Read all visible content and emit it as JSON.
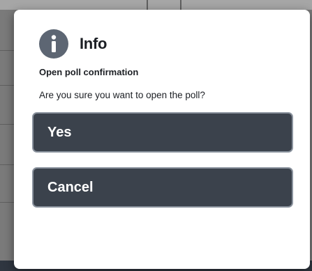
{
  "dialog": {
    "icon": "info-icon",
    "title": "Info",
    "subtitle": "Open poll confirmation",
    "message": "Are you sure you want to open the poll?",
    "buttons": {
      "yes_label": "Yes",
      "cancel_label": "Cancel"
    }
  },
  "colors": {
    "icon_background": "#5d6673",
    "button_background": "#3b424c",
    "button_border": "#8b939e",
    "dialog_background": "#ffffff"
  }
}
